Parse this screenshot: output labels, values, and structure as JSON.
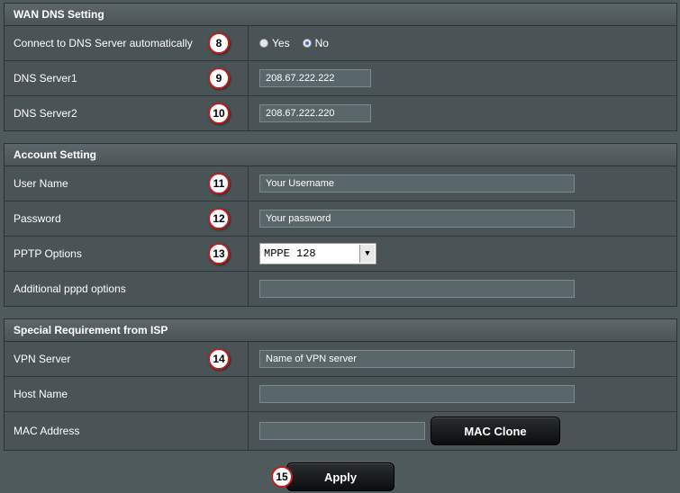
{
  "wan_dns": {
    "header": "WAN DNS Setting",
    "auto_label": "Connect to DNS Server automatically",
    "auto_badge": "8",
    "yes_label": "Yes",
    "no_label": "No",
    "auto_selected": "No",
    "dns1_label": "DNS Server1",
    "dns1_badge": "9",
    "dns1_value": "208.67.222.222",
    "dns2_label": "DNS Server2",
    "dns2_badge": "10",
    "dns2_value": "208.67.222.220"
  },
  "account": {
    "header": "Account Setting",
    "username_label": "User Name",
    "username_badge": "11",
    "username_value": "Your Username",
    "password_label": "Password",
    "password_badge": "12",
    "password_value": "Your password",
    "pptp_label": "PPTP Options",
    "pptp_badge": "13",
    "pptp_value": "MPPE 128",
    "pppd_label": "Additional pppd options",
    "pppd_value": ""
  },
  "isp": {
    "header": "Special Requirement from ISP",
    "vpn_label": "VPN Server",
    "vpn_badge": "14",
    "vpn_value": "Name of VPN server",
    "host_label": "Host Name",
    "host_value": "",
    "mac_label": "MAC Address",
    "mac_value": "",
    "mac_clone_label": "MAC Clone"
  },
  "footer": {
    "apply_badge": "15",
    "apply_label": "Apply"
  }
}
